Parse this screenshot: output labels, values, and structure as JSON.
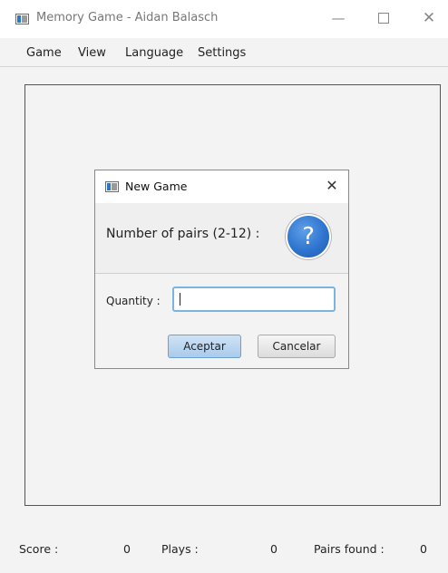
{
  "window": {
    "title": "Memory Game - Aidan Balasch",
    "minimize": "—",
    "close": "✕"
  },
  "menu": [
    "Game",
    "View",
    "Language",
    "Settings"
  ],
  "dialog": {
    "title": "New Game",
    "close": "✕",
    "message": "Number of pairs (2-12) :",
    "icon_glyph": "?",
    "quantity_label": "Quantity :",
    "quantity_value": "",
    "ok_label": "Aceptar",
    "cancel_label": "Cancelar"
  },
  "status": {
    "score_label": "Score :",
    "score_value": "0",
    "plays_label": "Plays :",
    "plays_value": "0",
    "pairs_label": "Pairs found :",
    "pairs_value": "0"
  }
}
